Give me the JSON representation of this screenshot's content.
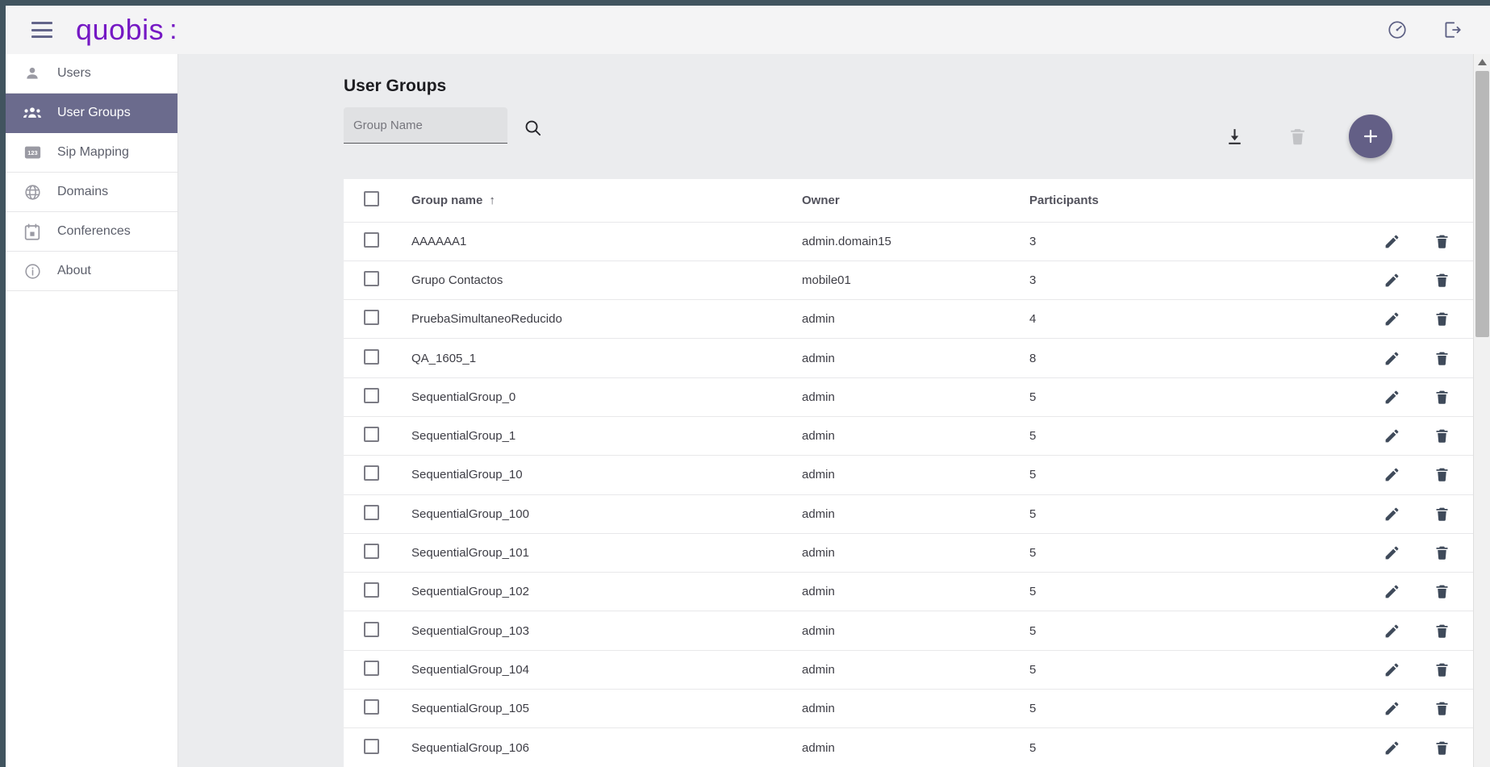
{
  "brand": {
    "name": "quobis",
    "mark": ":"
  },
  "header": {
    "menu_icon": "hamburger-menu-icon",
    "dashboard_icon": "speedometer-icon",
    "logout_icon": "logout-icon"
  },
  "sidebar": {
    "items": [
      {
        "label": "Users",
        "icon": "person-icon",
        "active": false
      },
      {
        "label": "User Groups",
        "icon": "group-icon",
        "active": true
      },
      {
        "label": "Sip Mapping",
        "icon": "numbers-icon",
        "active": false
      },
      {
        "label": "Domains",
        "icon": "globe-icon",
        "active": false
      },
      {
        "label": "Conferences",
        "icon": "calendar-icon",
        "active": false
      },
      {
        "label": "About",
        "icon": "info-icon",
        "active": false
      }
    ]
  },
  "main": {
    "title": "User Groups",
    "search": {
      "placeholder": "Group Name",
      "value": ""
    },
    "toolbar": {
      "download_label": "Download",
      "delete_label": "Delete",
      "add_label": "+"
    },
    "table": {
      "columns": [
        "Group name",
        "Owner",
        "Participants"
      ],
      "sort_column": "Group name",
      "sort_indicator": "↑",
      "rows": [
        {
          "name": "AAAAAA1",
          "owner": "admin.domain15",
          "participants": "3"
        },
        {
          "name": "Grupo Contactos",
          "owner": "mobile01",
          "participants": "3"
        },
        {
          "name": "PruebaSimultaneoReducido",
          "owner": "admin",
          "participants": "4"
        },
        {
          "name": "QA_1605_1",
          "owner": "admin",
          "participants": "8"
        },
        {
          "name": "SequentialGroup_0",
          "owner": "admin",
          "participants": "5"
        },
        {
          "name": "SequentialGroup_1",
          "owner": "admin",
          "participants": "5"
        },
        {
          "name": "SequentialGroup_10",
          "owner": "admin",
          "participants": "5"
        },
        {
          "name": "SequentialGroup_100",
          "owner": "admin",
          "participants": "5"
        },
        {
          "name": "SequentialGroup_101",
          "owner": "admin",
          "participants": "5"
        },
        {
          "name": "SequentialGroup_102",
          "owner": "admin",
          "participants": "5"
        },
        {
          "name": "SequentialGroup_103",
          "owner": "admin",
          "participants": "5"
        },
        {
          "name": "SequentialGroup_104",
          "owner": "admin",
          "participants": "5"
        },
        {
          "name": "SequentialGroup_105",
          "owner": "admin",
          "participants": "5"
        },
        {
          "name": "SequentialGroup_106",
          "owner": "admin",
          "participants": "5"
        }
      ]
    }
  },
  "colors": {
    "brand_purple": "#7518c4",
    "accent_slate_purple": "#635f86",
    "active_nav": "#6b6b8d",
    "top_strip": "#41545f",
    "page_bg": "#ebecee"
  }
}
